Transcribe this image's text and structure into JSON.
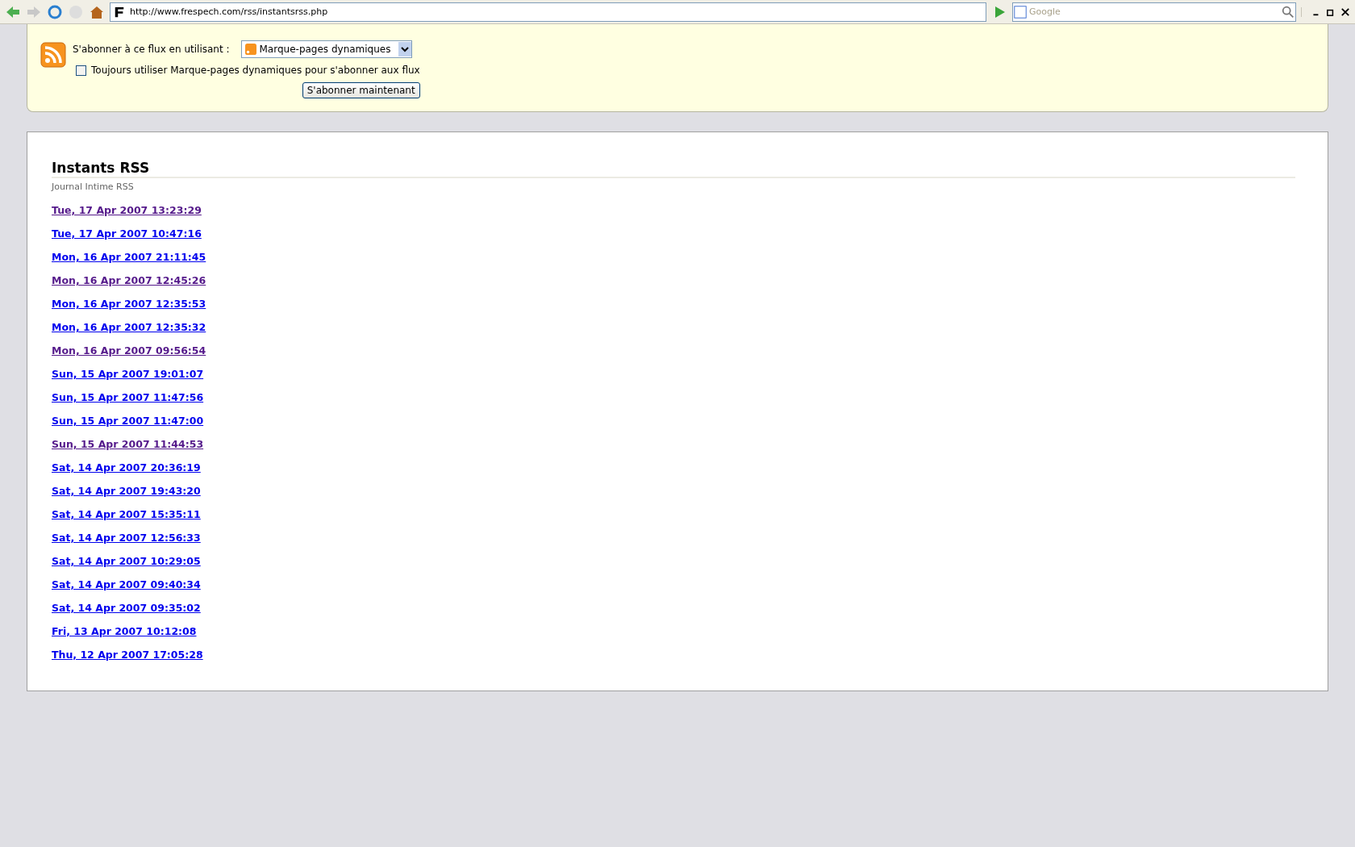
{
  "toolbar": {
    "url": "http://www.frespech.com/rss/instantsrss.php",
    "search_placeholder": "Google"
  },
  "subscribe": {
    "label": "S'abonner à ce flux en utilisant :",
    "reader": "Marque-pages dynamiques",
    "always_label": "Toujours utiliser Marque-pages dynamiques pour s'abonner aux flux",
    "always_checked": false,
    "button": "S'abonner maintenant"
  },
  "feed": {
    "title": "Instants RSS",
    "subtitle": "Journal Intime RSS",
    "items": [
      {
        "label": "Tue, 17 Apr 2007 13:23:29",
        "visited": true
      },
      {
        "label": "Tue, 17 Apr 2007 10:47:16",
        "visited": false
      },
      {
        "label": "Mon, 16 Apr 2007 21:11:45",
        "visited": false
      },
      {
        "label": "Mon, 16 Apr 2007 12:45:26",
        "visited": true
      },
      {
        "label": "Mon, 16 Apr 2007 12:35:53",
        "visited": false
      },
      {
        "label": "Mon, 16 Apr 2007 12:35:32",
        "visited": false
      },
      {
        "label": "Mon, 16 Apr 2007 09:56:54",
        "visited": true
      },
      {
        "label": "Sun, 15 Apr 2007 19:01:07",
        "visited": false
      },
      {
        "label": "Sun, 15 Apr 2007 11:47:56",
        "visited": false
      },
      {
        "label": "Sun, 15 Apr 2007 11:47:00",
        "visited": false
      },
      {
        "label": "Sun, 15 Apr 2007 11:44:53",
        "visited": true
      },
      {
        "label": "Sat, 14 Apr 2007 20:36:19",
        "visited": false
      },
      {
        "label": "Sat, 14 Apr 2007 19:43:20",
        "visited": false
      },
      {
        "label": "Sat, 14 Apr 2007 15:35:11",
        "visited": false
      },
      {
        "label": "Sat, 14 Apr 2007 12:56:33",
        "visited": false
      },
      {
        "label": "Sat, 14 Apr 2007 10:29:05",
        "visited": false
      },
      {
        "label": "Sat, 14 Apr 2007 09:40:34",
        "visited": false
      },
      {
        "label": "Sat, 14 Apr 2007 09:35:02",
        "visited": false
      },
      {
        "label": "Fri, 13 Apr 2007 10:12:08",
        "visited": false
      },
      {
        "label": "Thu, 12 Apr 2007 17:05:28",
        "visited": false
      }
    ]
  }
}
